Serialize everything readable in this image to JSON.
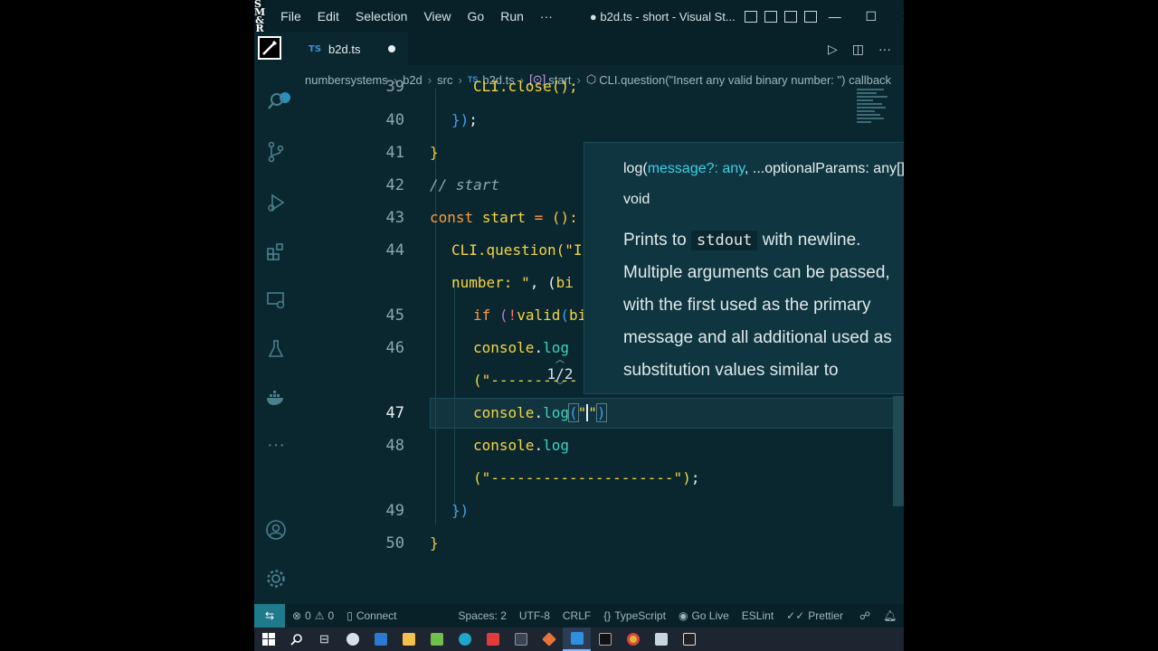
{
  "logo": {
    "line1": "S M",
    "line2": "&",
    "line3": "R"
  },
  "menu": [
    "File",
    "Edit",
    "Selection",
    "View",
    "Go",
    "Run",
    "···"
  ],
  "window_title": "● b2d.ts - short - Visual St...",
  "window_controls": {
    "minimize": "—",
    "maximize": "☐",
    "close": "✕"
  },
  "tab": {
    "badge": "TS",
    "label": "b2d.ts"
  },
  "breadcrumb": {
    "items": [
      "numbersystems",
      "b2d",
      "src"
    ],
    "file_badge": "TS",
    "file": "b2d.ts",
    "symbol1": "start",
    "symbol2": "CLI.question(\"Insert any valid binary number: \") callback"
  },
  "editor": {
    "line_numbers": [
      "39",
      "40",
      "41",
      "42",
      "43",
      "44",
      "45",
      "46",
      "47",
      "48",
      "49",
      "50"
    ],
    "current_line": "47",
    "lines": {
      "l39": "CLI.close();",
      "l40a": "})",
      "l40b": ";",
      "l41": "}",
      "l42": "// start",
      "l43a": "const",
      "l43b": "start",
      "l43c": "=",
      "l43d": "():",
      "l44a": "CLI",
      "l44b": ".question(",
      "l44c": "\"I",
      "l44d": "number: \"",
      "l44e": ", (",
      "l44f": "bi",
      "l45a": "if",
      "l45b": "(",
      "l45c": "!",
      "l45d": "valid",
      "l45e": "(",
      "l45f": "bi",
      "l46a": "console",
      "l46b": ".",
      "l46c": "log",
      "l46d": "(\"----------",
      "l47a": "console",
      "l47b": ".",
      "l47c": "log",
      "l47d": "(",
      "l47e": "\"",
      "l47f": "\"",
      "l47g": ")",
      "l48a": "console",
      "l48b": ".",
      "l48c": "log",
      "l48d": "(\"---------------------\")",
      "l48e": ";",
      "l49": "})",
      "l50": "}"
    }
  },
  "hover": {
    "sig_fn": "log(",
    "sig_param": "message?:",
    "sig_type": "any",
    "sig_rest": ", ...optionalParams: any[]):",
    "sig_return": "void",
    "doc_prefix": "Prints to",
    "doc_code": "stdout",
    "doc_suffix": "with newline. Multiple arguments can be passed, with the first used as the primary message and all additional used as substitution values similar to",
    "paging": "1/2"
  },
  "statusbar": {
    "remote": "⇆",
    "errors": "0",
    "warnings": "0",
    "connect": "Connect",
    "spaces": "Spaces: 2",
    "encoding": "UTF-8",
    "eol": "CRLF",
    "language": "TypeScript",
    "golive": "Go Live",
    "eslint": "ESLint",
    "prettier": "Prettier"
  },
  "colors": {
    "background": "#0a2730",
    "keyword": "#ff9a3c",
    "function": "#f5d442",
    "property": "#3fd0c0"
  }
}
